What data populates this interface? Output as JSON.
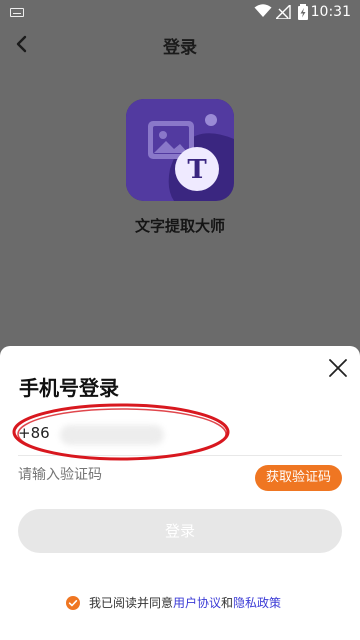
{
  "status_bar": {
    "time": "10:31"
  },
  "header": {
    "title": "登录"
  },
  "app": {
    "name": "文字提取大师",
    "logo_letter": "T"
  },
  "login_sheet": {
    "title": "手机号登录",
    "country_code": "+86",
    "code_placeholder": "请输入验证码",
    "get_code_label": "获取验证码",
    "login_label": "登录",
    "agreement": {
      "prefix": "我已阅读并同意",
      "user_agreement": "用户协议",
      "and": "和",
      "privacy_policy": "隐私政策"
    }
  },
  "colors": {
    "accent": "#ef7622",
    "link": "#3b3bd6",
    "logo_bg": "#3a2680",
    "overlay": "#6b6b6b",
    "highlight_ring": "#d8181f"
  },
  "icons": {
    "back": "chevron-left-icon",
    "close": "close-icon",
    "check": "check-circle-icon"
  }
}
